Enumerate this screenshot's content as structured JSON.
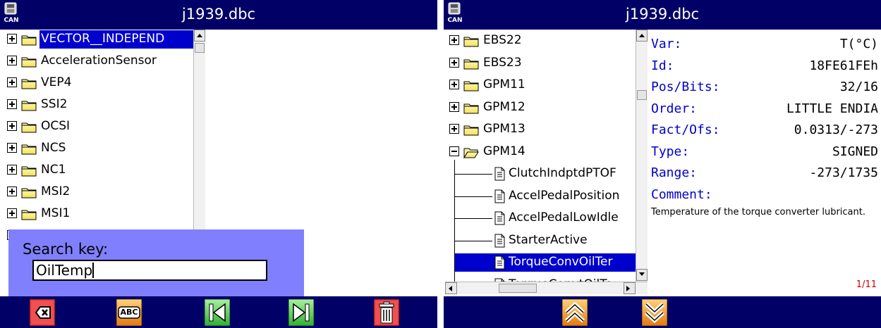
{
  "left": {
    "app_icon_label": "CAN",
    "title": "j1939.dbc",
    "tree_items": [
      {
        "label": "VECTOR__INDEPEND",
        "selected": true
      },
      {
        "label": "AccelerationSensor"
      },
      {
        "label": "VEP4"
      },
      {
        "label": "SSI2"
      },
      {
        "label": "OCSI"
      },
      {
        "label": "NCS"
      },
      {
        "label": "NC1"
      },
      {
        "label": "MSI2"
      },
      {
        "label": "MSI1"
      }
    ],
    "search": {
      "label": "Search key:",
      "value": "OilTemp"
    },
    "toolbar": {
      "backspace_icon": "backspace-icon",
      "keyboard_label": "ABC",
      "first_icon": "skip-first-icon",
      "last_icon": "skip-last-icon",
      "delete_icon": "trash-icon"
    }
  },
  "right": {
    "app_icon_label": "CAN",
    "title": "j1939.dbc",
    "tree_items": [
      {
        "label": "EBS22",
        "type": "folder",
        "expanded": false
      },
      {
        "label": "EBS23",
        "type": "folder",
        "expanded": false
      },
      {
        "label": "GPM11",
        "type": "folder",
        "expanded": false
      },
      {
        "label": "GPM12",
        "type": "folder",
        "expanded": false
      },
      {
        "label": "GPM13",
        "type": "folder",
        "expanded": false
      },
      {
        "label": "GPM14",
        "type": "folder",
        "expanded": true
      },
      {
        "label": "ClutchIndptdPTOF",
        "type": "signal"
      },
      {
        "label": "AccelPedalPosition",
        "type": "signal"
      },
      {
        "label": "AccelPedalLowIdle",
        "type": "signal"
      },
      {
        "label": "StarterActive",
        "type": "signal"
      },
      {
        "label": "TorqueConvOilTer",
        "type": "signal",
        "selected": true
      },
      {
        "label": "TorqueConvtOilTe",
        "type": "signal"
      }
    ],
    "properties": [
      {
        "key": "Var:",
        "value": "T(°C)"
      },
      {
        "key": "Id:",
        "value": "18FE61FEh"
      },
      {
        "key": "Pos/Bits:",
        "value": "32/16"
      },
      {
        "key": "Order:",
        "value": "LITTLE ENDIA"
      },
      {
        "key": "Fact/Ofs:",
        "value": "0.0313/-273"
      },
      {
        "key": "Type:",
        "value": "SIGNED"
      },
      {
        "key": "Range:",
        "value": "-273/1735"
      }
    ],
    "comment_label": "Comment:",
    "comment_text": "Temperature of the torque converter lubricant.",
    "page_indicator": "1/11",
    "toolbar": {
      "up_icon": "double-chevron-up-icon",
      "down_icon": "double-chevron-down-icon"
    }
  },
  "colors": {
    "titlebar": "#000066",
    "selection": "#0000cc",
    "search_panel": "#8080ff",
    "property_key": "#0000cc",
    "page_indicator": "#cc0000"
  }
}
